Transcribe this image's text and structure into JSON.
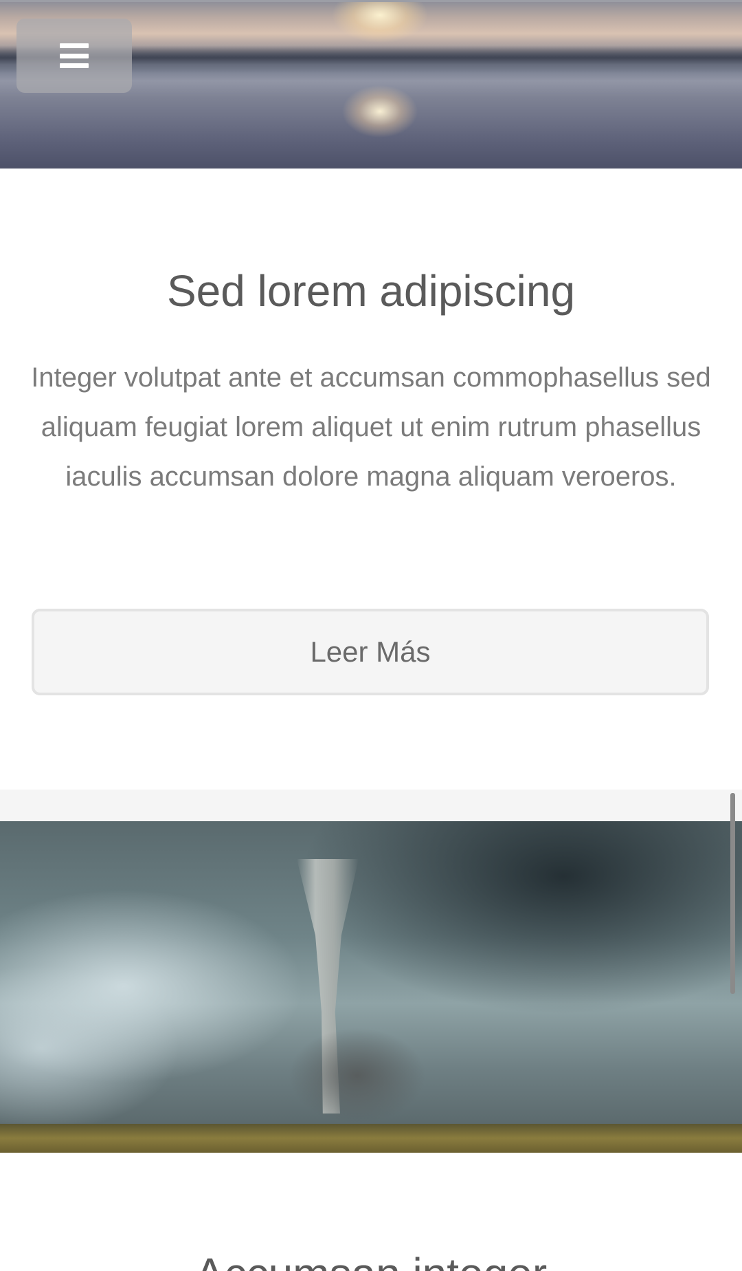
{
  "menu": {
    "icon": "hamburger-menu-icon"
  },
  "hero": {
    "image": "sunset-over-water"
  },
  "section1": {
    "title": "Sed lorem adipiscing",
    "body": "Integer volutpat ante et accumsan commophasellus sed aliquam feugiat lorem aliquet ut enim rutrum phasellus iaculis accumsan dolore magna aliquam veroeros.",
    "button_label": "Leer Más"
  },
  "section2": {
    "image": "tornado-landscape",
    "title": "Accumsan integer"
  }
}
